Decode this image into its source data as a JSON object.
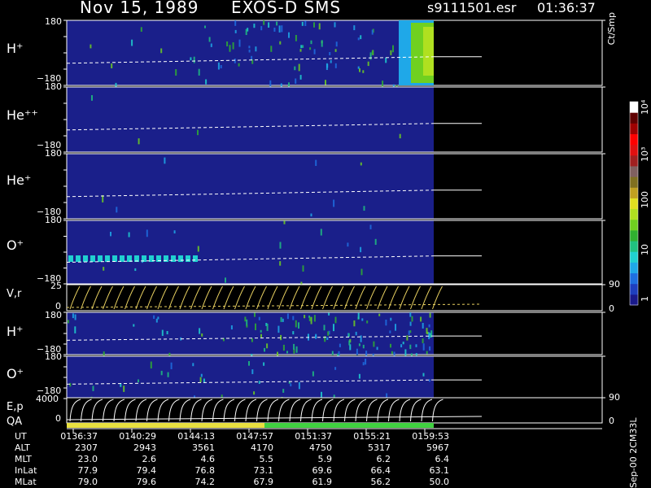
{
  "header": {
    "date": "Nov 15, 1989",
    "instrument": "EXOS-D SMS",
    "file": "s9111501.esr",
    "time": "01:36:37"
  },
  "colorbar": {
    "unit": "Ct/Smp",
    "labels": [
      "1",
      "10",
      "100",
      "10³",
      "10⁴"
    ],
    "colors": [
      "#1a1a8c",
      "#1e3fbf",
      "#1e6fe0",
      "#1fa8e8",
      "#20d0d0",
      "#20c080",
      "#30b030",
      "#70d020",
      "#b0e020",
      "#e0e020",
      "#c0a020",
      "#807020",
      "#806060",
      "#a02020",
      "#e01010",
      "#ff0000",
      "#a00000",
      "#600000",
      "#ffffff"
    ]
  },
  "panels": {
    "h_plus": {
      "label": "H⁺",
      "ytop": "180",
      "ybot": "−180"
    },
    "he_pp": {
      "label": "He⁺⁺",
      "ytop": "180",
      "ybot": "−180"
    },
    "he_plus": {
      "label": "He⁺",
      "ytop": "180",
      "ybot": "−180"
    },
    "o_plus": {
      "label": "O⁺",
      "ytop": "180",
      "ybot": "−180"
    },
    "vr": {
      "label": "V,r",
      "ytop": "25",
      "ybot": "0",
      "right_top": "90",
      "right_bot": "0"
    },
    "h_plus2": {
      "label": "H⁺",
      "ytop": "180",
      "ybot": "−180"
    },
    "o_plus2": {
      "label": "O⁺",
      "ytop": "180",
      "ybot": "−180"
    },
    "ep": {
      "label": "E,p",
      "ytop": "4000",
      "ybot": "0",
      "right_top": "90",
      "right_bot": "0"
    },
    "qa": {
      "label": "QA"
    }
  },
  "footer": {
    "rows": [
      {
        "name": "UT",
        "values": [
          "0136:37",
          "0140:29",
          "0144:13",
          "0147:57",
          "0151:37",
          "0155:21",
          "0159:53"
        ]
      },
      {
        "name": "ALT",
        "values": [
          "2307",
          "2943",
          "3561",
          "4170",
          "4750",
          "5317",
          "5967"
        ]
      },
      {
        "name": "MLT",
        "values": [
          "23.0",
          "2.6",
          "4.6",
          "5.5",
          "5.9",
          "6.2",
          "6.4"
        ]
      },
      {
        "name": "InLat",
        "values": [
          "77.9",
          "79.4",
          "76.8",
          "73.1",
          "69.6",
          "66.4",
          "63.1"
        ]
      },
      {
        "name": "MLat",
        "values": [
          "79.0",
          "79.6",
          "74.2",
          "67.9",
          "61.9",
          "56.2",
          "50.0"
        ]
      }
    ],
    "side_note": "Sep-00 2CM33L"
  },
  "chart_data": {
    "type": "heatmap",
    "x": [
      "0136:37",
      "0140:29",
      "0144:13",
      "0147:57",
      "0151:37",
      "0155:21",
      "0159:53"
    ],
    "xlabel": "UT",
    "colorscale": {
      "label": "Ct/Smp",
      "range": [
        1,
        10000
      ],
      "log": true
    },
    "series": [
      {
        "name": "H⁺",
        "ylim": [
          -180,
          180
        ]
      },
      {
        "name": "He⁺⁺",
        "ylim": [
          -180,
          180
        ]
      },
      {
        "name": "He⁺",
        "ylim": [
          -180,
          180
        ]
      },
      {
        "name": "O⁺",
        "ylim": [
          -180,
          180
        ]
      },
      {
        "name": "V,r",
        "ylim": [
          0,
          25
        ],
        "ylim_right": [
          0,
          90
        ]
      },
      {
        "name": "H⁺",
        "ylim": [
          -180,
          180
        ]
      },
      {
        "name": "O⁺",
        "ylim": [
          -180,
          180
        ]
      },
      {
        "name": "E,p",
        "ylim": [
          0,
          4000
        ],
        "ylim_right": [
          0,
          90
        ]
      }
    ]
  }
}
